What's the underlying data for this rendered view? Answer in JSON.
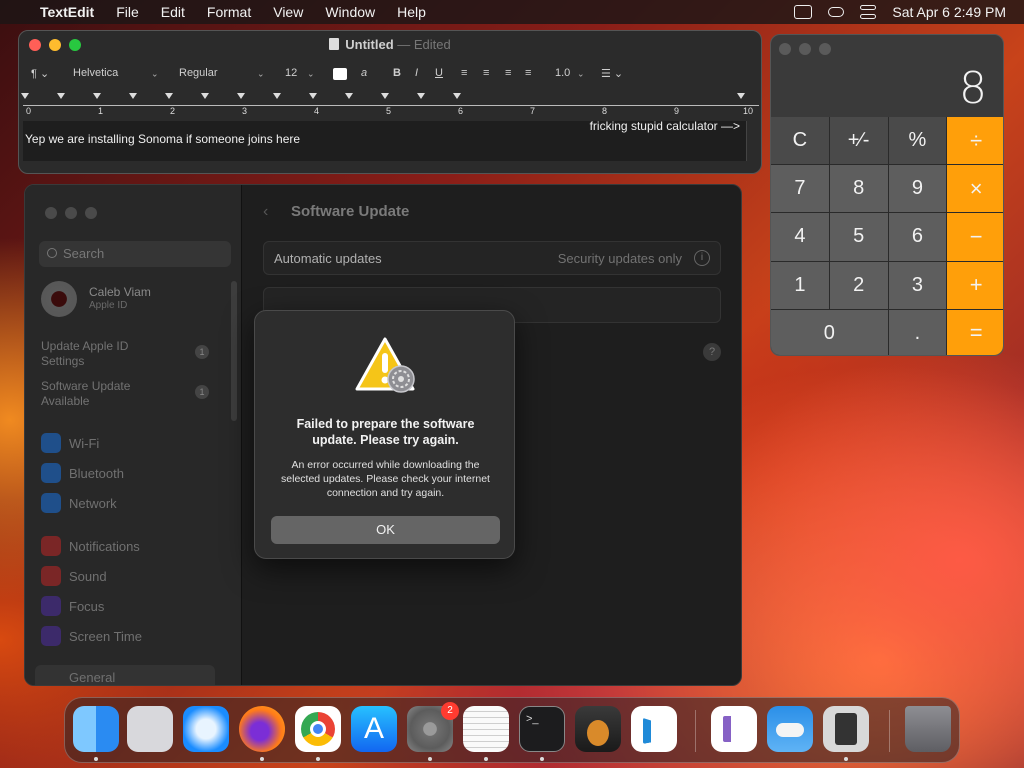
{
  "menubar": {
    "app": "TextEdit",
    "items": [
      "File",
      "Edit",
      "Format",
      "View",
      "Window",
      "Help"
    ],
    "datetime": "Sat Apr 6  2:49 PM"
  },
  "textedit": {
    "title": "Untitled",
    "status": "— Edited",
    "font_family": "Helvetica",
    "font_style": "Regular",
    "font_size": "12",
    "line_spacing": "1.0",
    "paragraph_glyph": "¶",
    "bold": "B",
    "italic": "I",
    "underline": "U",
    "ruler_numbers": [
      "0",
      "1",
      "2",
      "3",
      "4",
      "5",
      "6",
      "7",
      "8",
      "9",
      "10"
    ],
    "body_line1": "Yep we are installing Sonoma if someone joins here",
    "body_line2": "fricking stupid calculator —>"
  },
  "settings": {
    "search_placeholder": "Search",
    "user_name": "Caleb Viam",
    "user_sub": "Apple ID",
    "items": [
      {
        "label": "Update Apple ID Settings",
        "badge": "1"
      },
      {
        "label": "Software Update Available",
        "badge": "1"
      }
    ],
    "nav": [
      "Wi-Fi",
      "Bluetooth",
      "Network",
      "Notifications",
      "Sound",
      "Focus",
      "Screen Time"
    ],
    "general": "General",
    "page_title": "Software Update",
    "auto_updates_label": "Automatic updates",
    "auto_updates_value": "Security updates only",
    "help": "?"
  },
  "alert": {
    "title": "Failed to prepare the software update. Please try again.",
    "message": "An error occurred while downloading the selected updates. Please check your internet connection and try again.",
    "ok": "OK"
  },
  "calculator": {
    "display": "8",
    "keys": [
      "C",
      "+∕-",
      "%",
      "÷",
      "7",
      "8",
      "9",
      "×",
      "4",
      "5",
      "6",
      "−",
      "1",
      "2",
      "3",
      "+",
      "0",
      ".",
      "="
    ]
  },
  "dock": {
    "apps": [
      "finder-icon",
      "launchpad-icon",
      "safari-icon",
      "firefox-icon",
      "chrome-icon",
      "app-store-icon",
      "system-settings-icon",
      "textedit-icon",
      "terminal-icon",
      "garageband-icon",
      "vscode-icon",
      "visual-studio-icon",
      "weather-icon",
      "calculator-icon",
      "trash-icon"
    ],
    "settings_badge": "2"
  },
  "colors": {
    "accent_orange": "#ff9f0a",
    "alert_button": "#656565"
  }
}
